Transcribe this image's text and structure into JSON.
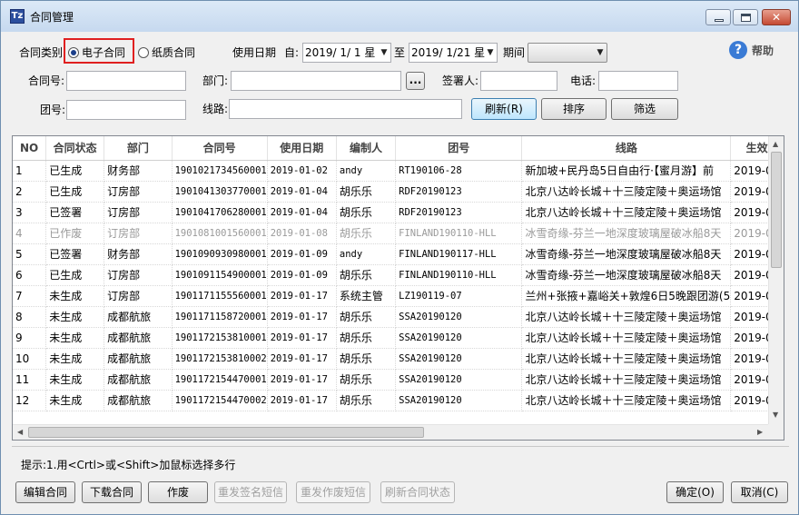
{
  "window": {
    "title": "合同管理",
    "icon_text": "Tz"
  },
  "filters": {
    "contract_type_label": "合同类别",
    "radio_electronic": "电子合同",
    "radio_paper": "纸质合同",
    "selected_type": "electronic",
    "use_date_label": "使用日期",
    "from_label": "自:",
    "from_date": "2019/ 1/ 1 星",
    "to_label": "至",
    "to_date": "2019/ 1/21 星",
    "period_label": "期间",
    "period_value": "",
    "contract_no_label": "合同号:",
    "contract_no_value": "",
    "department_label": "部门:",
    "department_value": "",
    "browse_button": "...",
    "signer_label": "签署人:",
    "signer_value": "",
    "phone_label": "电话:",
    "phone_value": "",
    "group_no_label": "团号:",
    "group_no_value": "",
    "route_label": "线路:",
    "route_value": ""
  },
  "actions": {
    "refresh": "刷新(R)",
    "sort": "排序",
    "filter": "筛选",
    "help": "帮助"
  },
  "table": {
    "columns": [
      "NO",
      "合同状态",
      "部门",
      "合同号",
      "使用日期",
      "编制人",
      "团号",
      "线路",
      "生效"
    ],
    "rows": [
      {
        "no": "1",
        "status": "已生成",
        "dept": "财务部",
        "contract_no": "1901021734560001",
        "date": "2019-01-02",
        "author": "andy",
        "group_no": "RT190106-28",
        "route": "新加坡+民丹岛5日自由行·【蜜月游】前",
        "effective": "2019-0",
        "dim": false
      },
      {
        "no": "2",
        "status": "已生成",
        "dept": "订房部",
        "contract_no": "1901041303770001",
        "date": "2019-01-04",
        "author": "胡乐乐",
        "group_no": "RDF20190123",
        "route": "北京八达岭长城＋十三陵定陵＋奥运场馆",
        "effective": "2019-0",
        "dim": false
      },
      {
        "no": "3",
        "status": "已签署",
        "dept": "订房部",
        "contract_no": "1901041706280001",
        "date": "2019-01-04",
        "author": "胡乐乐",
        "group_no": "RDF20190123",
        "route": "北京八达岭长城＋十三陵定陵＋奥运场馆",
        "effective": "2019-0",
        "dim": false
      },
      {
        "no": "4",
        "status": "已作废",
        "dept": "订房部",
        "contract_no": "1901081001560001",
        "date": "2019-01-08",
        "author": "胡乐乐",
        "group_no": "FINLAND190110-HLL",
        "route": "冰雪奇缘-芬兰一地深度玻璃屋破冰船8天",
        "effective": "2019-0",
        "dim": true
      },
      {
        "no": "5",
        "status": "已签署",
        "dept": "财务部",
        "contract_no": "1901090930980001",
        "date": "2019-01-09",
        "author": "andy",
        "group_no": "FINLAND190117-HLL",
        "route": "冰雪奇缘-芬兰一地深度玻璃屋破冰船8天",
        "effective": "2019-0",
        "dim": false
      },
      {
        "no": "6",
        "status": "已生成",
        "dept": "订房部",
        "contract_no": "1901091154900001",
        "date": "2019-01-09",
        "author": "胡乐乐",
        "group_no": "FINLAND190110-HLL",
        "route": "冰雪奇缘-芬兰一地深度玻璃屋破冰船8天",
        "effective": "2019-0",
        "dim": false
      },
      {
        "no": "7",
        "status": "未生成",
        "dept": "订房部",
        "contract_no": "1901171155560001",
        "date": "2019-01-17",
        "author": "系统主管",
        "group_no": "LZ190119-07",
        "route": "兰州+张掖+嘉峪关+敦煌6日5晚跟团游(5",
        "effective": "2019-0",
        "dim": false
      },
      {
        "no": "8",
        "status": "未生成",
        "dept": "成都航旅",
        "contract_no": "1901171158720001",
        "date": "2019-01-17",
        "author": "胡乐乐",
        "group_no": "SSA20190120",
        "route": "北京八达岭长城＋十三陵定陵＋奥运场馆",
        "effective": "2019-0",
        "dim": false
      },
      {
        "no": "9",
        "status": "未生成",
        "dept": "成都航旅",
        "contract_no": "1901172153810001",
        "date": "2019-01-17",
        "author": "胡乐乐",
        "group_no": "SSA20190120",
        "route": "北京八达岭长城＋十三陵定陵＋奥运场馆",
        "effective": "2019-0",
        "dim": false
      },
      {
        "no": "10",
        "status": "未生成",
        "dept": "成都航旅",
        "contract_no": "1901172153810002",
        "date": "2019-01-17",
        "author": "胡乐乐",
        "group_no": "SSA20190120",
        "route": "北京八达岭长城＋十三陵定陵＋奥运场馆",
        "effective": "2019-0",
        "dim": false
      },
      {
        "no": "11",
        "status": "未生成",
        "dept": "成都航旅",
        "contract_no": "1901172154470001",
        "date": "2019-01-17",
        "author": "胡乐乐",
        "group_no": "SSA20190120",
        "route": "北京八达岭长城＋十三陵定陵＋奥运场馆",
        "effective": "2019-0",
        "dim": false
      },
      {
        "no": "12",
        "status": "未生成",
        "dept": "成都航旅",
        "contract_no": "1901172154470002",
        "date": "2019-01-17",
        "author": "胡乐乐",
        "group_no": "SSA20190120",
        "route": "北京八达岭长城＋十三陵定陵＋奥运场馆",
        "effective": "2019-0",
        "dim": false
      }
    ]
  },
  "tip": "提示:1.用<Crtl>或<Shift>加鼠标选择多行",
  "bottom_buttons": {
    "edit": "编辑合同",
    "download": "下载合同",
    "void": "作废",
    "resend_sign_sms": "重发签名短信",
    "resend_void_sms": "重发作废短信",
    "refresh_status": "刷新合同状态",
    "ok": "确定(O)",
    "cancel": "取消(C)"
  }
}
